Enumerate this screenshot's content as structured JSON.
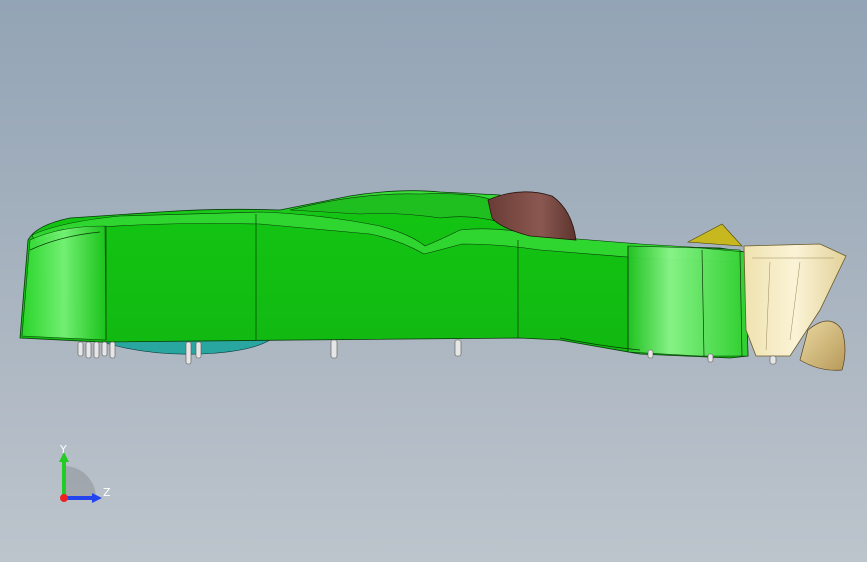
{
  "viewport": {
    "background_top": "#93a4b6",
    "background_bottom": "#bcc4cc"
  },
  "model": {
    "body_color": "#12c212",
    "body_highlight": "#5cf05c",
    "body_shadow": "#0a8c0a",
    "seat_color": "#7a4a44",
    "nose_color": "#f2e6b8",
    "wing_color": "#c8b820",
    "floor_color": "#2aa6a0",
    "fastener_color": "#e6e6e6",
    "edge_color": "#0a3a0a"
  },
  "triad": {
    "y_label": "Y",
    "z_label": "Z",
    "y_color": "#22cc22",
    "z_color": "#2244ee",
    "x_color": "#ee2222"
  }
}
